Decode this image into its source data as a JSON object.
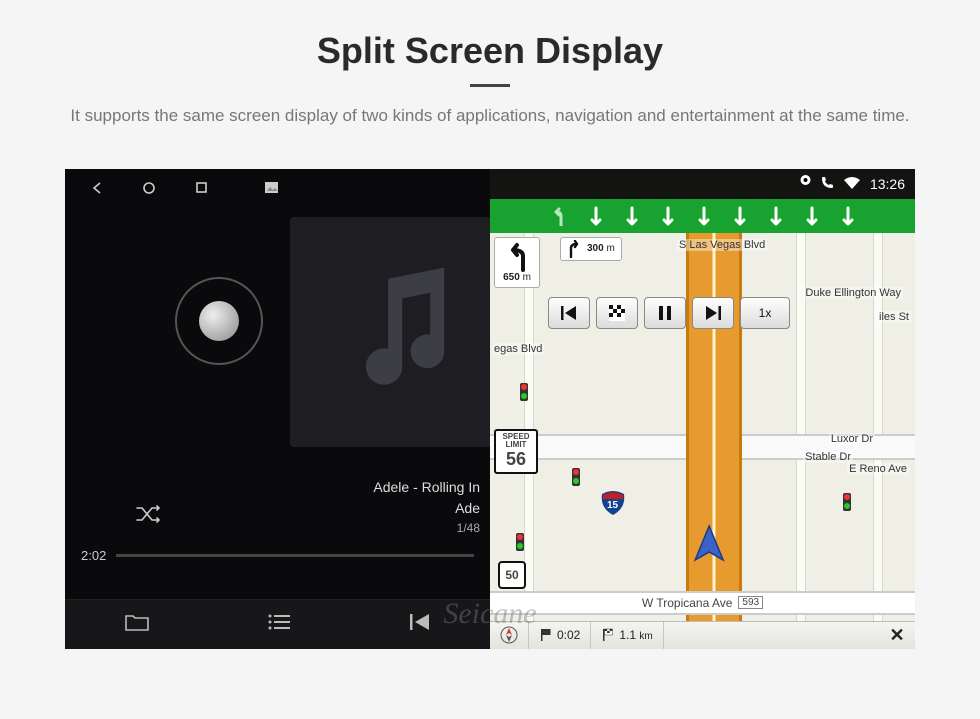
{
  "header": {
    "title": "Split Screen Display",
    "subtitle": "It supports the same screen display of two kinds of applications, navigation and entertainment at the same time."
  },
  "music": {
    "track_title": "Adele - Rolling In",
    "track_artist": "Ade",
    "track_index": "1/48",
    "elapsed": "2:02"
  },
  "status": {
    "time": "13:26"
  },
  "nav": {
    "street_top": "S Las Vegas Blvd",
    "street_right1": "Duke Ellington Way",
    "street_right2": "Luxor Dr",
    "street_right3": "E Reno Ave",
    "street_right4": "Stable Dr",
    "street_bottom": "W Tropicana Ave",
    "street_bottom_num": "593",
    "street_left": "egas Blvd",
    "street_tiles": "iles St",
    "turn_distance": "650",
    "turn_unit": "m",
    "next_turn_distance": "300",
    "next_turn_unit": "m",
    "speed_limit_label": "SPEED LIMIT",
    "speed_limit_value": "56",
    "route_shield": "50",
    "interstate": "15",
    "sim_speed": "1x",
    "eta_time": "0:02",
    "eta_dist": "1.1",
    "eta_dist_unit": "km"
  },
  "watermark": "Seicane"
}
